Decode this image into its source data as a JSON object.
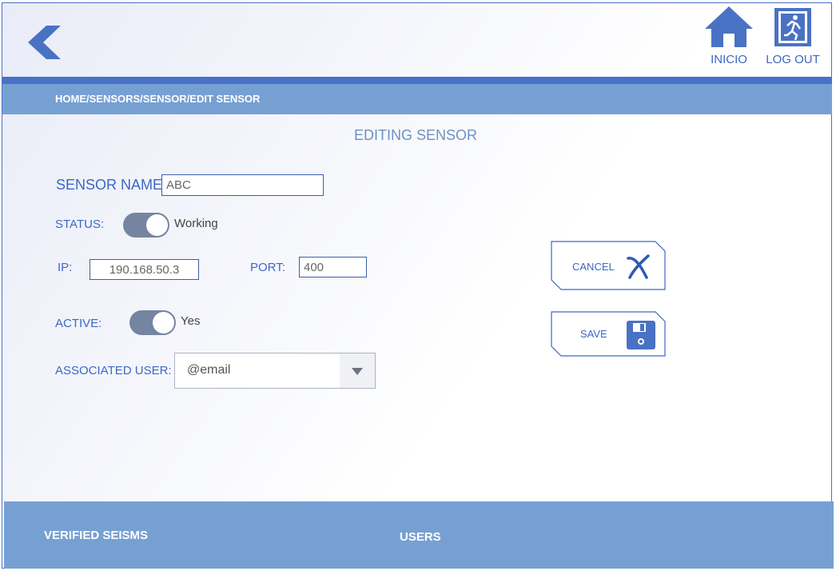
{
  "header": {
    "home_label": "INICIO",
    "logout_label": "LOG OUT"
  },
  "breadcrumb": "HOME/SENSORS/SENSOR/EDIT SENSOR",
  "page_title": "EDITING SENSOR",
  "form": {
    "sensor_name_label": "SENSOR NAME",
    "sensor_name_value": "ABC",
    "status_label": "STATUS:",
    "status_text": "Working",
    "ip_label": "IP:",
    "ip_value": "190.168.50.3",
    "port_label": "PORT:",
    "port_value": "400",
    "active_label": "ACTIVE:",
    "active_text": "Yes",
    "associated_user_label": "ASSOCIATED USER:",
    "associated_user_value": "@email"
  },
  "actions": {
    "cancel_label": "CANCEL",
    "save_label": "SAVE"
  },
  "footer": {
    "verified_seisms": "VERIFIED SEISMS",
    "users": "USERS"
  },
  "colors": {
    "accent": "#3d67c4",
    "bar": "#77a0d2",
    "toggle": "#7584a0"
  }
}
